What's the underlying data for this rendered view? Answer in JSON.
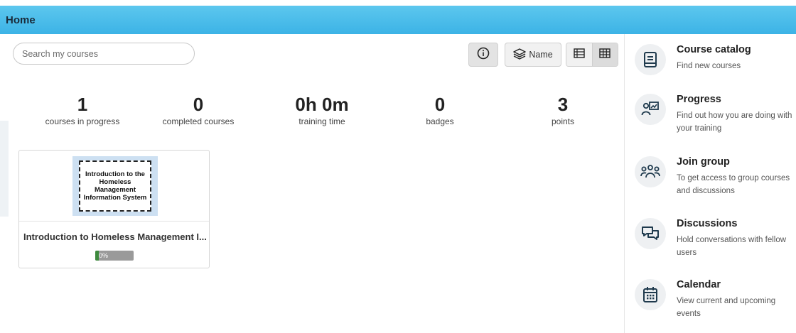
{
  "header": {
    "title": "Home"
  },
  "search": {
    "placeholder": "Search my courses"
  },
  "toolbar": {
    "info_icon": "info-icon",
    "sort_label": "Name",
    "sort_icon": "layers-icon",
    "view_list_icon": "list-view-icon",
    "view_grid_icon": "grid-view-icon"
  },
  "stats": [
    {
      "value": "1",
      "label": "courses in progress"
    },
    {
      "value": "0",
      "label": "completed courses"
    },
    {
      "value": "0h 0m",
      "label": "training time"
    },
    {
      "value": "0",
      "label": "badges"
    },
    {
      "value": "3",
      "label": "points"
    }
  ],
  "course": {
    "thumb_text": "Introduction to the Homeless Management Information System",
    "title": "Introduction to Homeless Management I...",
    "progress_label": "0%",
    "progress": 0
  },
  "sidebar": {
    "items": [
      {
        "title": "Course catalog",
        "desc": "Find new courses",
        "icon": "book-icon"
      },
      {
        "title": "Progress",
        "desc": "Find out how you are doing with your training",
        "icon": "progress-chart-icon"
      },
      {
        "title": "Join group",
        "desc": "To get access to group courses and discussions",
        "icon": "group-icon"
      },
      {
        "title": "Discussions",
        "desc": "Hold conversations with fellow users",
        "icon": "chat-icon"
      },
      {
        "title": "Calendar",
        "desc": "View current and upcoming events",
        "icon": "calendar-icon"
      }
    ]
  },
  "colors": {
    "header": "#3cb3e6",
    "icon": "#1f3a4d",
    "progress_fill": "#3e8a3e"
  }
}
